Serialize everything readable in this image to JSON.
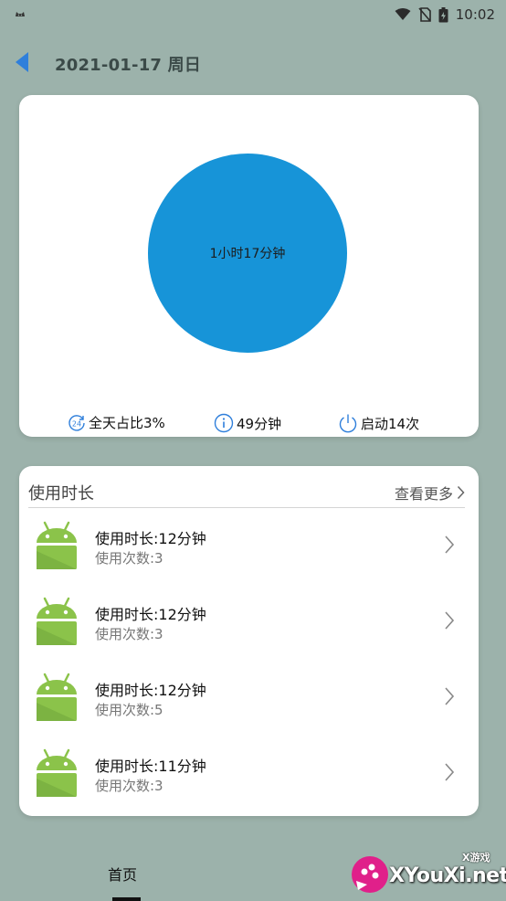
{
  "status_bar": {
    "time": "10:02",
    "left_icon": "cat-notification-icon",
    "icons": [
      "wifi-icon",
      "no-sim-icon",
      "battery-icon"
    ]
  },
  "header": {
    "back_icon": "back-arrow-icon",
    "title": "2021-01-17 周日",
    "accent_color": "#2f7fdb"
  },
  "summary": {
    "pie_center_label": "1小时17分钟",
    "pie_color": "#1794d8",
    "stats": [
      {
        "icon": "24h-clock-icon",
        "label": "全天占比3%"
      },
      {
        "icon": "info-circle-icon",
        "label": "49分钟"
      },
      {
        "icon": "power-icon",
        "label": "启动14次"
      }
    ]
  },
  "usage": {
    "title": "使用时长",
    "see_more": "查看更多",
    "apps": [
      {
        "icon": "android-app-icon",
        "duration": "使用时长:12分钟",
        "count": "使用次数:3"
      },
      {
        "icon": "android-app-icon",
        "duration": "使用时长:12分钟",
        "count": "使用次数:3"
      },
      {
        "icon": "android-app-icon",
        "duration": "使用时长:12分钟",
        "count": "使用次数:5"
      },
      {
        "icon": "android-app-icon",
        "duration": "使用时长:11分钟",
        "count": "使用次数:3"
      }
    ]
  },
  "bottom_nav": {
    "tabs": [
      {
        "label": "首页",
        "active": true
      }
    ]
  },
  "watermark": {
    "text": "XYouXi.net",
    "sub": "X游戏"
  }
}
